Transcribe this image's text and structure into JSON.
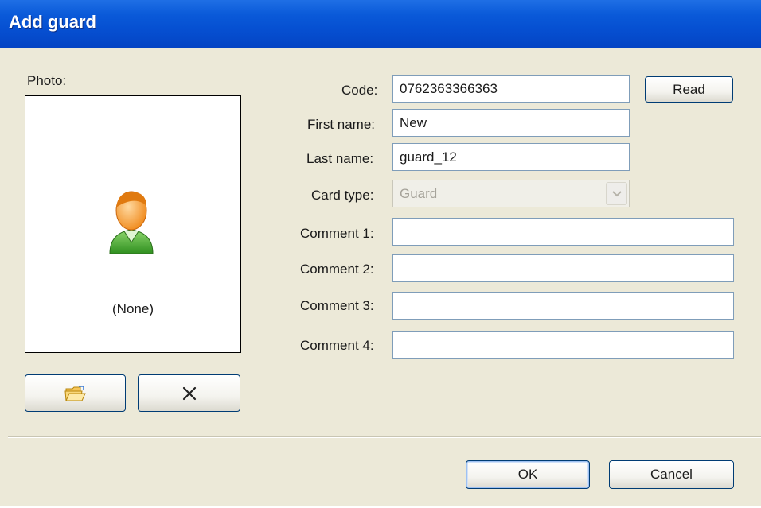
{
  "dialog": {
    "title": "Add guard"
  },
  "photo": {
    "label": "Photo:",
    "placeholder_text": "(None)",
    "browse_icon": "open-folder-icon",
    "clear_icon": "close-x-icon",
    "avatar_icon": "user-avatar-icon"
  },
  "form": {
    "code": {
      "label": "Code:",
      "value": "0762363366363"
    },
    "read_button": "Read",
    "first_name": {
      "label": "First name:",
      "value": "New"
    },
    "last_name": {
      "label": "Last name:",
      "value": "guard_12"
    },
    "card_type": {
      "label": "Card type:",
      "value": "Guard"
    },
    "comment1": {
      "label": "Comment 1:",
      "value": ""
    },
    "comment2": {
      "label": "Comment 2:",
      "value": ""
    },
    "comment3": {
      "label": "Comment 3:",
      "value": ""
    },
    "comment4": {
      "label": "Comment 4:",
      "value": ""
    }
  },
  "footer": {
    "ok": "OK",
    "cancel": "Cancel"
  },
  "colors": {
    "titlebar": "#0a5ad9",
    "dialog_background": "#ece9d8",
    "field_border": "#7f9db9",
    "button_border": "#003c74"
  }
}
